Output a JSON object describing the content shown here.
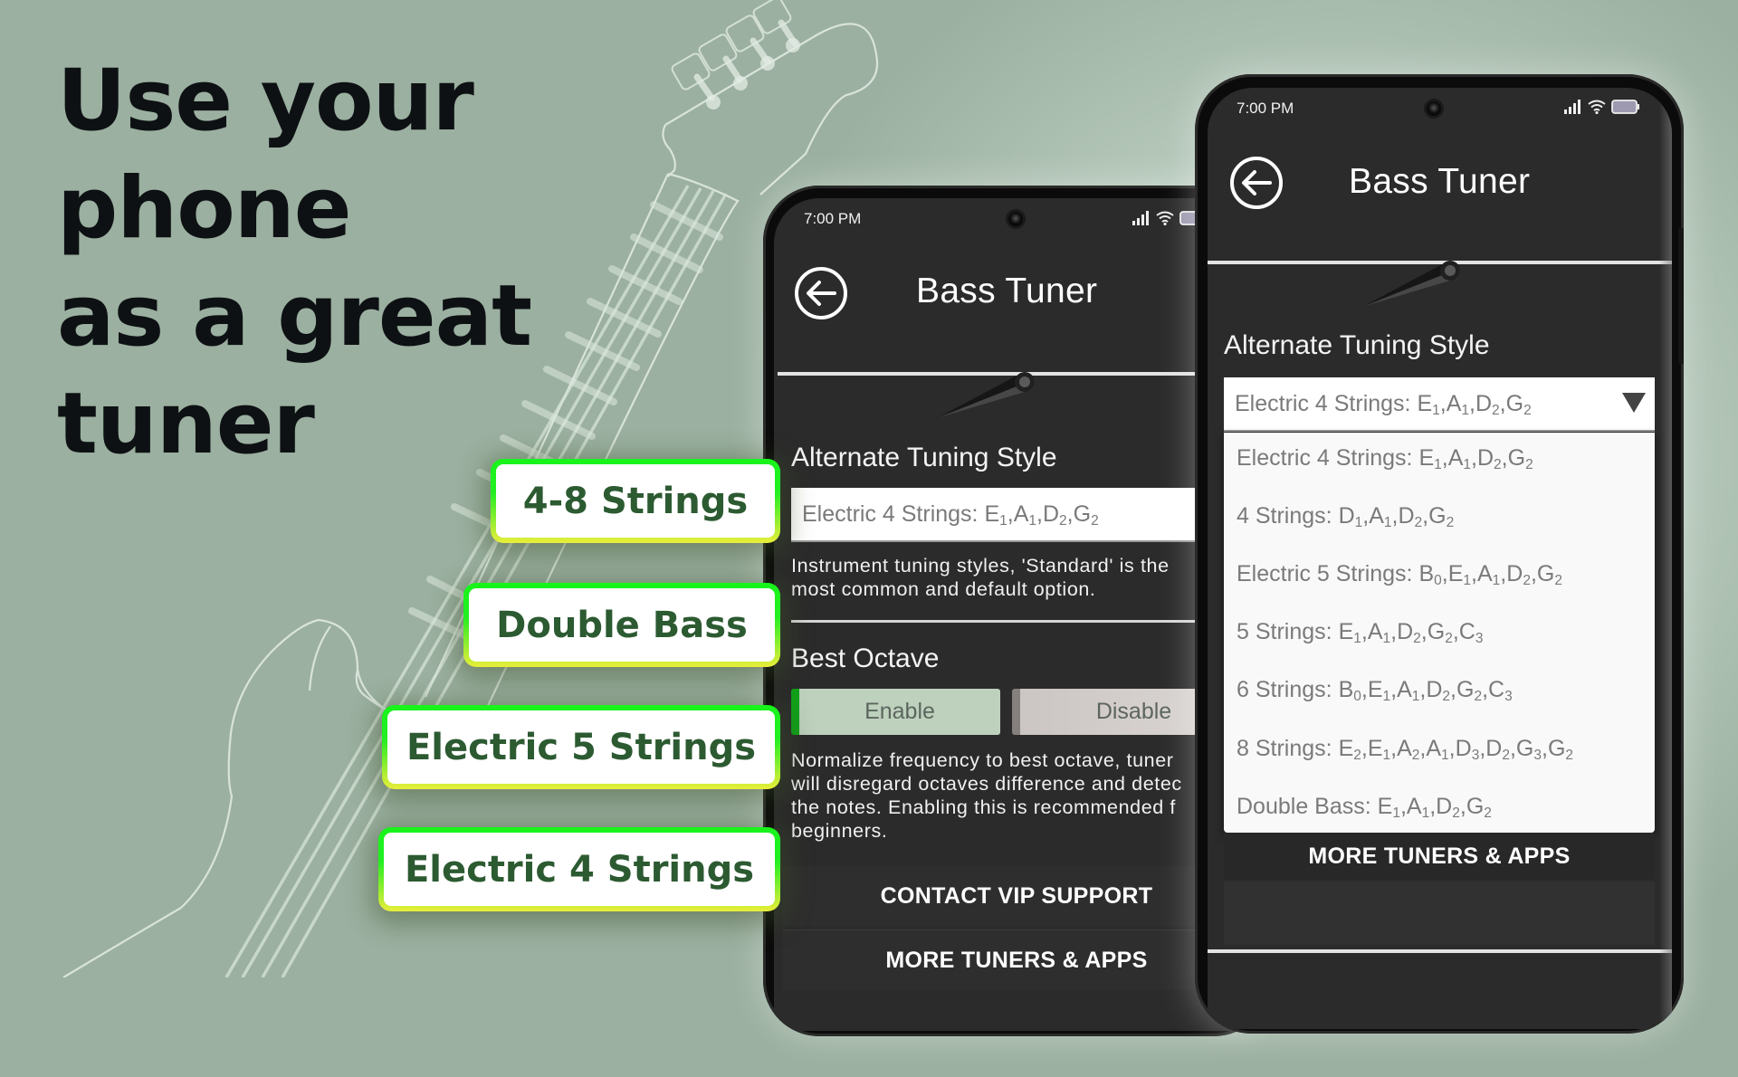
{
  "headline": {
    "lines": [
      "Use your",
      "phone",
      "as a great",
      "tuner"
    ]
  },
  "feature_tags": [
    {
      "label": "4-8 Strings"
    },
    {
      "label": "Double Bass"
    },
    {
      "label": "Electric 5 Strings"
    },
    {
      "label": "Electric 4 Strings"
    }
  ],
  "colors": {
    "background": "#9bb0a0",
    "tag_text": "#2c5a31",
    "tag_border_top": "#17f51a",
    "tag_border_bottom": "#e9ee3a",
    "screen_bg": "#2b2b2b",
    "enable_accent": "#11a11a"
  },
  "phone_left": {
    "status_time": "7:00 PM",
    "icons": [
      "signal-icon",
      "wifi-icon",
      "battery-icon"
    ],
    "back_icon": "arrow-left-circle-icon",
    "title": "Bass Tuner",
    "tuning_label": "Alternate Tuning Style",
    "tuning_selected": {
      "prefix": "Electric 4 Strings: ",
      "notes": [
        [
          "E",
          "1"
        ],
        [
          "A",
          "1"
        ],
        [
          "D",
          "2"
        ],
        [
          "G",
          "2"
        ]
      ]
    },
    "tuning_desc_lines": [
      "Instrument tuning styles, 'Standard' is the",
      "most common and default option."
    ],
    "octave_label": "Best Octave",
    "enable_label": "Enable",
    "disable_label": "Disable",
    "octave_desc_lines": [
      "Normalize frequency to best octave, tuner",
      "will disregard octaves difference and detec",
      "the notes. Enabling this is recommended f",
      "beginners."
    ],
    "contact_button": "CONTACT VIP SUPPORT",
    "more_button": "MORE TUNERS & APPS"
  },
  "phone_right": {
    "status_time": "7:00 PM",
    "icons": [
      "signal-icon",
      "wifi-icon",
      "battery-icon"
    ],
    "back_icon": "arrow-left-circle-icon",
    "title": "Bass Tuner",
    "tuning_label": "Alternate Tuning Style",
    "tuning_selected": {
      "prefix": "Electric 4 Strings: ",
      "notes": [
        [
          "E",
          "1"
        ],
        [
          "A",
          "1"
        ],
        [
          "D",
          "2"
        ],
        [
          "G",
          "2"
        ]
      ]
    },
    "dropdown_options": [
      {
        "prefix": "Electric 4 Strings: ",
        "notes": [
          [
            "E",
            "1"
          ],
          [
            "A",
            "1"
          ],
          [
            "D",
            "2"
          ],
          [
            "G",
            "2"
          ]
        ]
      },
      {
        "prefix": "4 Strings: ",
        "notes": [
          [
            "D",
            "1"
          ],
          [
            "A",
            "1"
          ],
          [
            "D",
            "2"
          ],
          [
            "G",
            "2"
          ]
        ]
      },
      {
        "prefix": "Electric 5 Strings: ",
        "notes": [
          [
            "B",
            "0"
          ],
          [
            "E",
            "1"
          ],
          [
            "A",
            "1"
          ],
          [
            "D",
            "2"
          ],
          [
            "G",
            "2"
          ]
        ]
      },
      {
        "prefix": "5 Strings: ",
        "notes": [
          [
            "E",
            "1"
          ],
          [
            "A",
            "1"
          ],
          [
            "D",
            "2"
          ],
          [
            "G",
            "2"
          ],
          [
            "C",
            "3"
          ]
        ]
      },
      {
        "prefix": "6 Strings: ",
        "notes": [
          [
            "B",
            "0"
          ],
          [
            "E",
            "1"
          ],
          [
            "A",
            "1"
          ],
          [
            "D",
            "2"
          ],
          [
            "G",
            "2"
          ],
          [
            "C",
            "3"
          ]
        ]
      },
      {
        "prefix": "8 Strings: ",
        "notes": [
          [
            "E",
            "2"
          ],
          [
            "E",
            "1"
          ],
          [
            "A",
            "2"
          ],
          [
            "A",
            "1"
          ],
          [
            "D",
            "3"
          ],
          [
            "D",
            "2"
          ],
          [
            "G",
            "3"
          ],
          [
            "G",
            "2"
          ]
        ]
      },
      {
        "prefix": "Double Bass: ",
        "notes": [
          [
            "E",
            "1"
          ],
          [
            "A",
            "1"
          ],
          [
            "D",
            "2"
          ],
          [
            "G",
            "2"
          ]
        ]
      }
    ],
    "more_button": "MORE TUNERS & APPS"
  }
}
